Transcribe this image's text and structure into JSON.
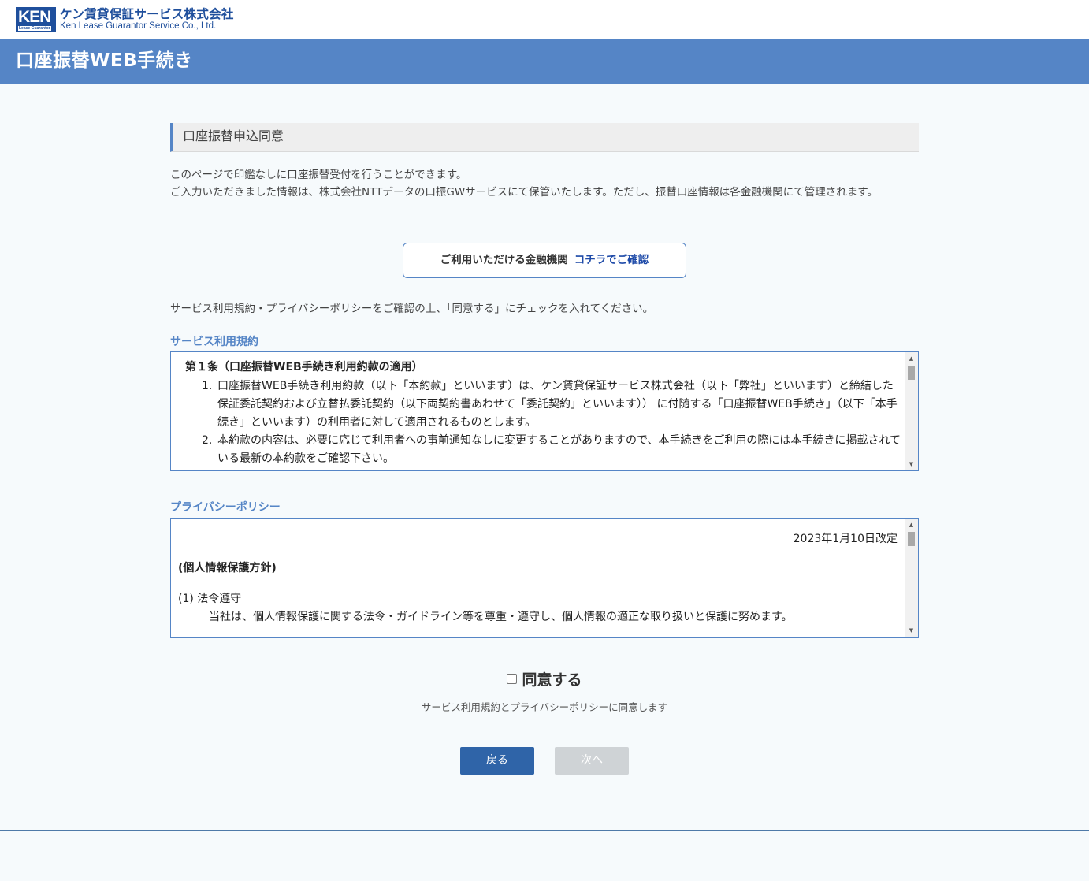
{
  "logo": {
    "mark": "KEN",
    "mark_sub": "Lease Guarantor",
    "name_jp": "ケン賃貸保証サービス株式会社",
    "name_en": "Ken Lease Guarantor Service Co., Ltd."
  },
  "page_title": "口座振替WEB手続き",
  "section_title": "口座振替申込同意",
  "intro": {
    "line1": "このページで印鑑なしに口座振替受付を行うことができます。",
    "line2": "ご入力いただきました情報は、株式会社NTTデータの口振GWサービスにて保管いたします。ただし、振替口座情報は各金融機関にて管理されます。"
  },
  "financial_button": {
    "label": "ご利用いただける金融機関",
    "link": "コチラでご確認"
  },
  "instruction": "サービス利用規約・プライバシーポリシーをご確認の上、「同意する」にチェックを入れてください。",
  "terms": {
    "label": "サービス利用規約",
    "heading": "第１条（口座振替WEB手続き利用約款の適用）",
    "items": [
      {
        "num": "1.",
        "text": "口座振替WEB手続き利用約款（以下「本約款」といいます）は、ケン賃貸保証サービス株式会社（以下「弊社」といいます）と締結した保証委託契約および立替払委託契約（以下両契約書あわせて「委託契約」といいます）） に付随する「口座振替WEB手続き」（以下「本手続き」といいます）の利用者に対して適用されるものとします。"
      },
      {
        "num": "2.",
        "text": "本約款の内容は、必要に応じて利用者への事前通知なしに変更することがありますので、本手続きをご利用の際には本手続きに掲載されている最新の本約款をご確認下さい。"
      }
    ]
  },
  "privacy": {
    "label": "プライバシーポリシー",
    "revised_date": "2023年1月10日改定",
    "title": "(個人情報保護方針)",
    "section1_heading": "(1) 法令遵守",
    "section1_text": "当社は、個人情報保護に関する法令・ガイドライン等を尊重・遵守し、個人情報の適正な取り扱いと保護に努めます。"
  },
  "agree": {
    "label": "同意する",
    "checked": false,
    "description": "サービス利用規約とプライバシーポリシーに同意します"
  },
  "buttons": {
    "back": "戻る",
    "next": "次へ"
  }
}
